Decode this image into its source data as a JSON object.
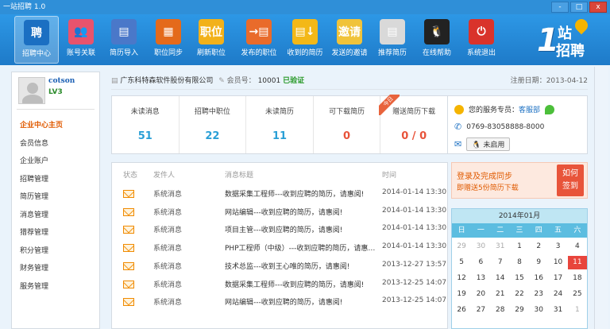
{
  "window": {
    "title": "一站招聘 1.0",
    "buttons": [
      "-",
      "□",
      "x"
    ]
  },
  "toolbar": {
    "items": [
      {
        "label": "招聘中心",
        "glyph": "聘",
        "color": "#1b6fc2"
      },
      {
        "label": "账号关联",
        "glyph": "👥",
        "color": "#e8536d"
      },
      {
        "label": "简历导入",
        "glyph": "▤",
        "color": "#4a78c9"
      },
      {
        "label": "职位同步",
        "glyph": "▦",
        "color": "#e46a1b"
      },
      {
        "label": "刷新职位",
        "glyph": "职位",
        "color": "#f2b11a"
      },
      {
        "label": "发布的职位",
        "glyph": "→▤",
        "color": "#e96b2b"
      },
      {
        "label": "收到的简历",
        "glyph": "▤↓",
        "color": "#f3b818"
      },
      {
        "label": "发送的邀请",
        "glyph": "邀请",
        "color": "#f0c33a"
      },
      {
        "label": "推荐简历",
        "glyph": "▤",
        "color": "#d9d9d9"
      },
      {
        "label": "在线帮助",
        "glyph": "🐧",
        "color": "#222222"
      },
      {
        "label": "系统退出",
        "glyph": "⏻",
        "color": "#d9332b"
      }
    ],
    "logo": {
      "one": "1",
      "zhan": "站",
      "zp": "招聘"
    }
  },
  "user": {
    "name": "cotson",
    "level": "LV3"
  },
  "menu": [
    "企业中心主页",
    "会员信息",
    "企业账户",
    "招聘管理",
    "简历管理",
    "消息管理",
    "猎荐管理",
    "积分管理",
    "财务管理",
    "服务管理"
  ],
  "company": {
    "name": "广东科特森软件股份有限公司",
    "member_label": "会员号：",
    "member_no": "10001",
    "verified": "已验证",
    "reg_label": "注册日期：",
    "reg_date": "2013-04-12"
  },
  "stats": [
    {
      "label": "未读消息",
      "value": "51",
      "color": "#2a9fd6"
    },
    {
      "label": "招聘中职位",
      "value": "22",
      "color": "#2a9fd6"
    },
    {
      "label": "未读简历",
      "value": "11",
      "color": "#2a9fd6"
    },
    {
      "label": "可下载简历",
      "value": "0",
      "color": "#e8533a"
    },
    {
      "label": "赠送简历下载",
      "value": "0 / 0",
      "color": "#e8533a",
      "ribbon": "今日"
    }
  ],
  "service": {
    "label": "您的服务专员：",
    "name": "客服部",
    "phone": "0769-83058888-8000",
    "status": "未启用"
  },
  "messages": {
    "headers": [
      "状态",
      "发件人",
      "消息标题",
      "时间"
    ],
    "rows": [
      {
        "sender": "系统消息",
        "title": "数据采集工程师---收到应聘的简历，请惠阅!",
        "time": "2014-01-14 13:30"
      },
      {
        "sender": "系统消息",
        "title": "网站编辑---收到应聘的简历，请惠阅!",
        "time": "2014-01-14 13:30"
      },
      {
        "sender": "系统消息",
        "title": "项目主管---收到应聘的简历，请惠阅!",
        "time": "2014-01-14 13:30"
      },
      {
        "sender": "系统消息",
        "title": "PHP工程师（中级）---收到应聘的简历，请惠阅!",
        "time": "2014-01-14 13:30"
      },
      {
        "sender": "系统消息",
        "title": "技术总监---收到王心唯的简历，请惠阅!",
        "time": "2013-12-27 13:57"
      },
      {
        "sender": "系统消息",
        "title": "数据采集工程师---收到应聘的简历，请惠阅!",
        "time": "2013-12-25 14:07"
      },
      {
        "sender": "系统消息",
        "title": "网站编辑---收到应聘的简历，请惠阅!",
        "time": "2013-12-25 14:07"
      }
    ]
  },
  "promo": {
    "line1": "登录及完成同步",
    "line2": "即赠送5份简历下载",
    "signin1": "如何",
    "signin2": "签到"
  },
  "calendar": {
    "month": "2014年01月",
    "weekdays": [
      "日",
      "一",
      "二",
      "三",
      "四",
      "五",
      "六"
    ],
    "days": [
      "29",
      "30",
      "31",
      "1",
      "2",
      "3",
      "4",
      "5",
      "6",
      "7",
      "8",
      "9",
      "10",
      "11",
      "12",
      "13",
      "14",
      "15",
      "16",
      "17",
      "18",
      "19",
      "20",
      "21",
      "22",
      "23",
      "24",
      "25",
      "26",
      "27",
      "28",
      "29",
      "30",
      "31",
      "1"
    ],
    "other_month": [
      0,
      1,
      2,
      34
    ],
    "today_index": 13
  }
}
